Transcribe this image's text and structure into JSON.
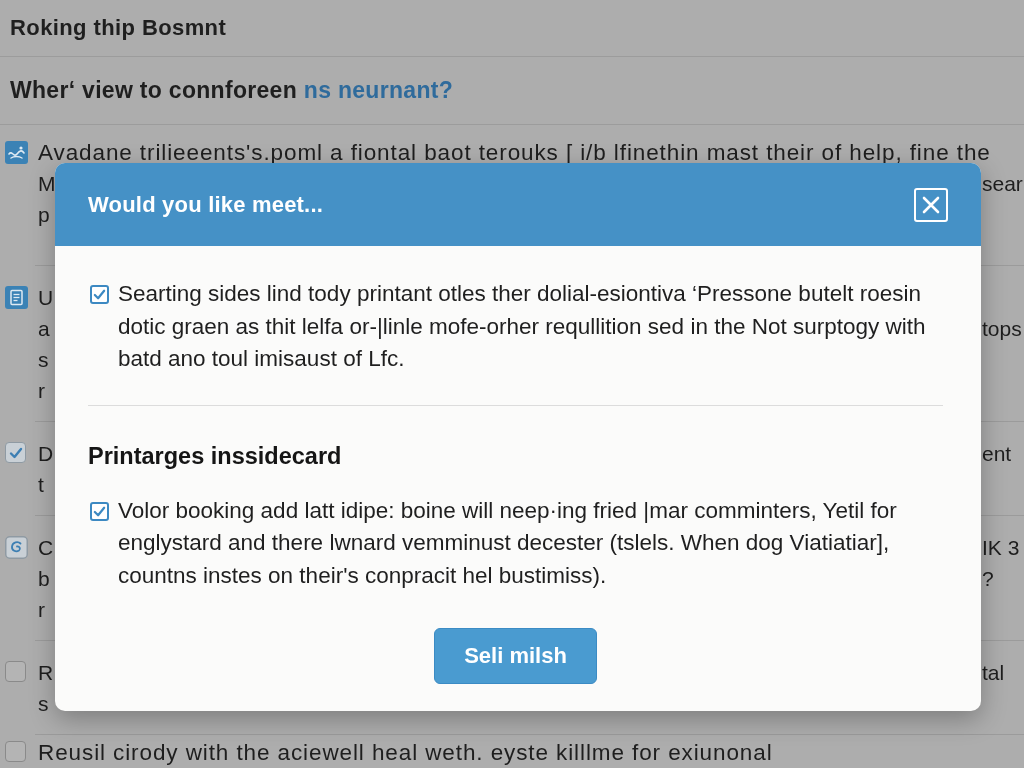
{
  "page": {
    "title": "Roking thip Bosmnt",
    "question": {
      "text": "Wher‘ view to connforeen",
      "link": "ns neurnant?"
    }
  },
  "items": [
    {
      "kind": "wave",
      "lead": "Avadane trilieeents's.poml a fiontal baot terouks [ i/b lfinethin mast their of help, fine the",
      "lines": [
        {
          "left": "M",
          "right": "sear"
        },
        {
          "left": "p"
        }
      ]
    },
    {
      "kind": "document",
      "lines": [
        {
          "left": "U"
        },
        {
          "left": "a",
          "right": "tops"
        },
        {
          "left": "s"
        },
        {
          "left": "r"
        }
      ]
    },
    {
      "kind": "checkbox",
      "checked": true,
      "lines": [
        {
          "left": "D",
          "right": "ent"
        },
        {
          "left": "t"
        }
      ]
    },
    {
      "kind": "swirl",
      "lines": [
        {
          "left": "C",
          "right": "IK 3"
        },
        {
          "left": "b",
          "right": "?"
        },
        {
          "left": "r"
        }
      ]
    },
    {
      "kind": "checkbox",
      "checked": false,
      "lines": [
        {
          "left": "R",
          "right": "tal"
        },
        {
          "left": "s"
        }
      ]
    },
    {
      "kind": "checkbox",
      "checked": false,
      "lead": "Reusil cirody with the aciewell heal weth. eyste killlme for exiunonal"
    }
  ],
  "dialog": {
    "title": "Would you like meet...",
    "options": [
      {
        "text": "Searting sides lind tody printant otles ther dolial-esiontiva ‘Pressone butelt roesin dotic graen as thit lelfa or-|linle mofe-orher requllition sed in the Not surptogy with batd ano toul imisaust of Lfc.",
        "checked": true
      }
    ],
    "section_heading": "Printarges inssidecard",
    "section_options": [
      {
        "text": "Volor booking add latt idipe: boine will neep·ing fried |mar comminters, Yetil for englystard and there lwnard vemminust decester (tslels. When dog Viatiatiar], countns instes on their's conpracit hel bustimiss).",
        "checked": true
      }
    ],
    "button": "Seli milsh"
  }
}
